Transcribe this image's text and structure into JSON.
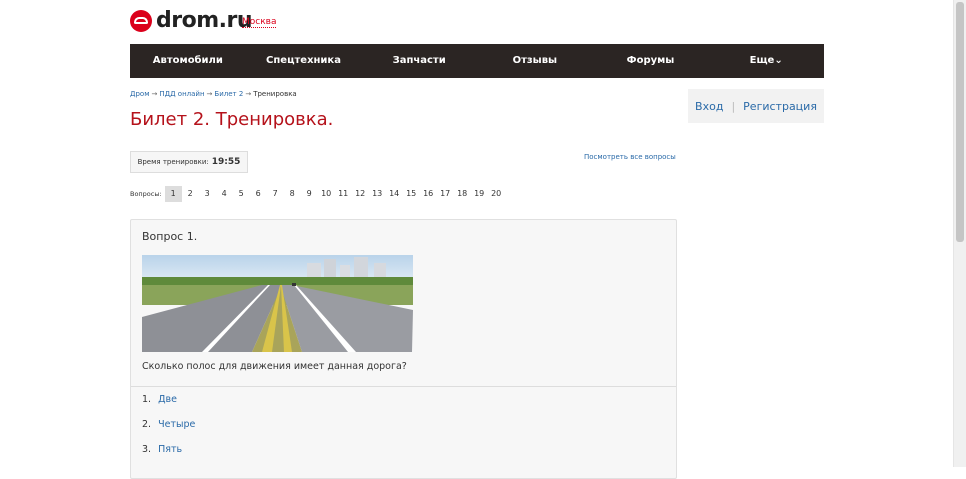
{
  "header": {
    "logo_text": "drom.ru",
    "city": "Москва"
  },
  "nav": {
    "items": [
      "Автомобили",
      "Спецтехника",
      "Запчасти",
      "Отзывы",
      "Форумы",
      "Еще⌄"
    ]
  },
  "breadcrumb": {
    "items": [
      "Дром",
      "ПДД онлайн",
      "Билет 2",
      "Тренировка"
    ],
    "separator": "→"
  },
  "page_title": "Билет 2. Тренировка.",
  "auth": {
    "login": "Вход",
    "separator": "|",
    "register": "Регистрация"
  },
  "timer": {
    "label": "Время тренировки:",
    "value": "19:55"
  },
  "all_questions_link": "Посмотреть все вопросы",
  "questions_nav": {
    "label": "Вопросы:",
    "numbers": [
      "1",
      "2",
      "3",
      "4",
      "5",
      "6",
      "7",
      "8",
      "9",
      "10",
      "11",
      "12",
      "13",
      "14",
      "15",
      "16",
      "17",
      "18",
      "19",
      "20"
    ],
    "active_index": 0
  },
  "question": {
    "heading": "Вопрос 1.",
    "image_icon": "road-photo",
    "text": "Сколько полос для движения имеет данная дорога?",
    "answers": [
      {
        "num": "1.",
        "text": "Две"
      },
      {
        "num": "2.",
        "text": "Четыре"
      },
      {
        "num": "3.",
        "text": "Пять"
      }
    ]
  },
  "colors": {
    "brand_red": "#db001b",
    "title_red": "#b5121b",
    "nav_bg": "#2b2523",
    "link_blue": "#2a6aa8"
  }
}
